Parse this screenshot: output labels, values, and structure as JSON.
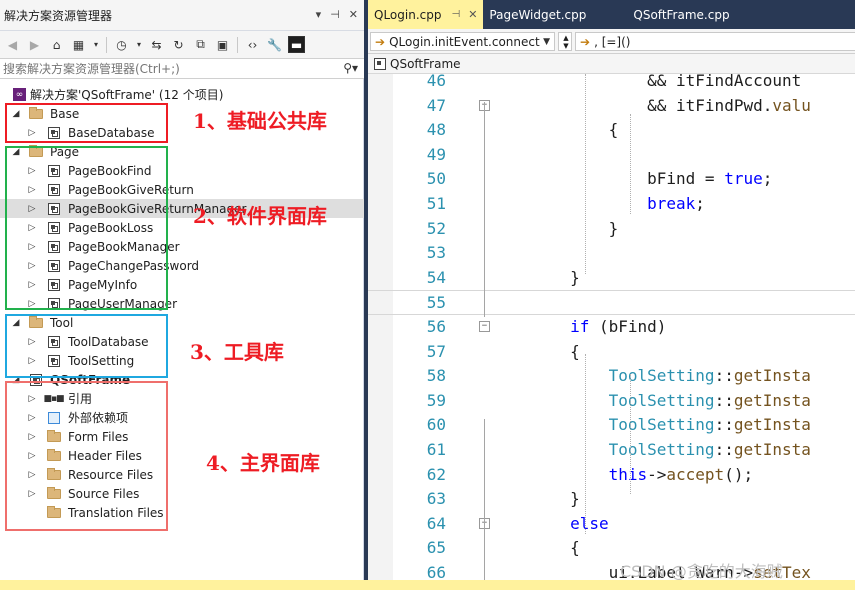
{
  "solution_explorer": {
    "title": "解决方案资源管理器",
    "search_placeholder": "搜索解决方案资源管理器(Ctrl+;)",
    "solution_label": "解决方案'QSoftFrame' (12 个项目)",
    "tree": [
      {
        "label": "Base",
        "kind": "folder",
        "expander": "open",
        "depth": 1
      },
      {
        "label": "BaseDatabase",
        "kind": "project",
        "expander": "closed",
        "depth": 2
      },
      {
        "label": "Page",
        "kind": "folder",
        "expander": "open",
        "depth": 1
      },
      {
        "label": "PageBookFind",
        "kind": "project",
        "expander": "closed",
        "depth": 2
      },
      {
        "label": "PageBookGiveReturn",
        "kind": "project",
        "expander": "closed",
        "depth": 2
      },
      {
        "label": "PageBookGiveReturnManager",
        "kind": "project",
        "expander": "closed",
        "depth": 2,
        "selected": true
      },
      {
        "label": "PageBookLoss",
        "kind": "project",
        "expander": "closed",
        "depth": 2
      },
      {
        "label": "PageBookManager",
        "kind": "project",
        "expander": "closed",
        "depth": 2
      },
      {
        "label": "PageChangePassword",
        "kind": "project",
        "expander": "closed",
        "depth": 2
      },
      {
        "label": "PageMyInfo",
        "kind": "project",
        "expander": "closed",
        "depth": 2
      },
      {
        "label": "PageUserManager",
        "kind": "project",
        "expander": "closed",
        "depth": 2
      },
      {
        "label": "Tool",
        "kind": "folder",
        "expander": "open",
        "depth": 1
      },
      {
        "label": "ToolDatabase",
        "kind": "project",
        "expander": "closed",
        "depth": 2
      },
      {
        "label": "ToolSetting",
        "kind": "project",
        "expander": "closed",
        "depth": 2
      },
      {
        "label": "QSoftFrame",
        "kind": "project",
        "expander": "open",
        "depth": 1,
        "bold": true
      },
      {
        "label": "引用",
        "kind": "references",
        "expander": "closed",
        "depth": 2
      },
      {
        "label": "外部依赖项",
        "kind": "external",
        "expander": "closed",
        "depth": 2
      },
      {
        "label": "Form Files",
        "kind": "filter",
        "expander": "closed",
        "depth": 2
      },
      {
        "label": "Header Files",
        "kind": "filter",
        "expander": "closed",
        "depth": 2
      },
      {
        "label": "Resource Files",
        "kind": "filter",
        "expander": "closed",
        "depth": 2
      },
      {
        "label": "Source Files",
        "kind": "filter",
        "expander": "closed",
        "depth": 2
      },
      {
        "label": "Translation Files",
        "kind": "filter",
        "expander": "none",
        "depth": 2
      }
    ]
  },
  "annotations": [
    {
      "label": "1、基础公共库",
      "color": "#ee1c24"
    },
    {
      "label": "2、软件界面库",
      "color": "#ee1c24"
    },
    {
      "label": "3、工具库",
      "color": "#ee1c24"
    },
    {
      "label": "4、主界面库",
      "color": "#ee1c24"
    }
  ],
  "annotation_box_colors": [
    "#ee1c24",
    "#22b14c",
    "#1fa8e0",
    "#ef6f6c"
  ],
  "editor": {
    "tabs": [
      {
        "label": "QLogin.cpp",
        "active": true
      },
      {
        "label": "PageWidget.cpp",
        "active": false
      },
      {
        "label": "QSoftFrame.cpp",
        "active": false
      }
    ],
    "nav_left": "QLogin.initEvent.connect",
    "nav_right": ", [=]()",
    "scope": "QSoftFrame",
    "code_lines": [
      {
        "n": "46",
        "text": "                && itFindAccount"
      },
      {
        "n": "47",
        "text": "                && itFindPwd.valu"
      },
      {
        "n": "48",
        "text": "            {"
      },
      {
        "n": "49",
        "text": ""
      },
      {
        "n": "50",
        "text": "                bFind = true;"
      },
      {
        "n": "51",
        "text": "                break;"
      },
      {
        "n": "52",
        "text": "            }"
      },
      {
        "n": "53",
        "text": ""
      },
      {
        "n": "54",
        "text": "        }"
      },
      {
        "n": "55",
        "text": ""
      },
      {
        "n": "56",
        "text": "        if (bFind)"
      },
      {
        "n": "57",
        "text": "        {"
      },
      {
        "n": "58",
        "text": "            ToolSetting::getInsta"
      },
      {
        "n": "59",
        "text": "            ToolSetting::getInsta"
      },
      {
        "n": "60",
        "text": "            ToolSetting::getInsta"
      },
      {
        "n": "61",
        "text": "            ToolSetting::getInsta"
      },
      {
        "n": "62",
        "text": "            this->accept();"
      },
      {
        "n": "63",
        "text": "        }"
      },
      {
        "n": "64",
        "text": "        else"
      },
      {
        "n": "65",
        "text": "        {"
      },
      {
        "n": "66",
        "text": "            ui.Label_Warn->setTex"
      }
    ],
    "watermark": "CSDN @贪吃的大海贼"
  },
  "colors": {
    "frame": "#293955",
    "active_tab": "#fff29d",
    "line_number": "#2b91af",
    "keyword": "#0000ff",
    "type": "#2b91af"
  }
}
